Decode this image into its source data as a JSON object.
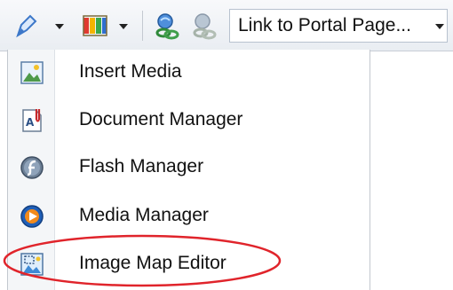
{
  "toolbar": {
    "icons": [
      "link-pencil-icon",
      "colors-palette-icon",
      "link-icon",
      "unlink-icon"
    ],
    "link_combo_label": "Link to Portal Page..."
  },
  "menu": {
    "items": [
      {
        "label": "Insert Media",
        "icon": "insert-media-icon"
      },
      {
        "label": "Document Manager",
        "icon": "document-manager-icon"
      },
      {
        "label": "Flash Manager",
        "icon": "flash-manager-icon"
      },
      {
        "label": "Media Manager",
        "icon": "media-manager-icon"
      },
      {
        "label": "Image Map Editor",
        "icon": "image-map-editor-icon"
      }
    ]
  },
  "annotation": {
    "ellipse_color": "#e0242b"
  }
}
